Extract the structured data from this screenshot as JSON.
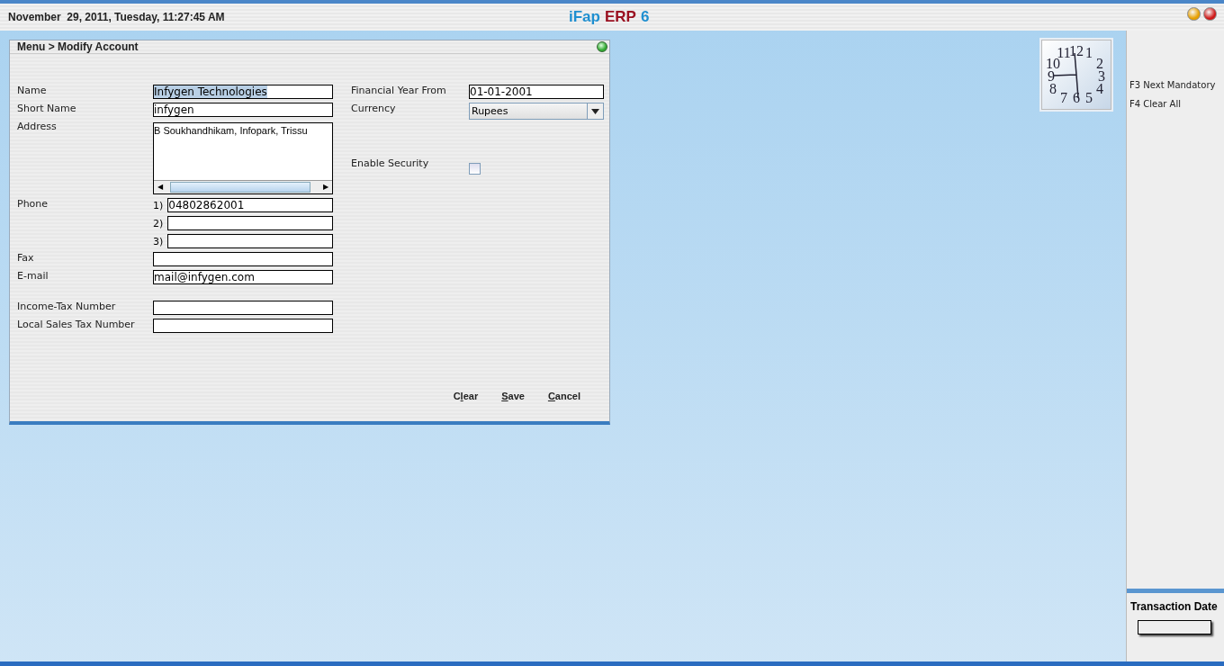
{
  "header": {
    "datetime": "November  29, 2011, Tuesday, 11:27:45 AM",
    "title": [
      {
        "text": "iFap",
        "color": "#1f8fd0"
      },
      {
        "text": "ERP",
        "color": "#9a1020"
      },
      {
        "text": "6",
        "color": "#1f8fd0"
      }
    ]
  },
  "panel": {
    "breadcrumb": "Menu > Modify Account",
    "left_fields": [
      {
        "kind": "text",
        "label": "Name",
        "value": "Infygen Technologies",
        "text_selected": true
      },
      {
        "kind": "text",
        "label": "Short Name",
        "value": "infygen"
      },
      {
        "kind": "textarea",
        "label": "Address",
        "value": "B Soukhandhikam, Infopark, Trissu",
        "scroll_left": "◀",
        "scroll_right": "▶"
      },
      {
        "kind": "phone",
        "label": "Phone",
        "lines": [
          {
            "number": "1)",
            "value": "04802862001"
          },
          {
            "number": "2)"
          },
          {
            "number": "3)"
          }
        ]
      },
      {
        "kind": "text",
        "label": "Fax"
      },
      {
        "kind": "text",
        "label": "E-mail",
        "value": "mail@infygen.com"
      },
      {
        "kind": "gap"
      },
      {
        "kind": "text",
        "label": "Income-Tax Number"
      },
      {
        "kind": "text",
        "label": "Local Sales Tax Number"
      }
    ],
    "right_fields": [
      {
        "kind": "text",
        "label": "Financial Year From",
        "value": "01-01-2001"
      },
      {
        "kind": "select",
        "label": "Currency",
        "value": "Rupees"
      },
      {
        "kind": "gap"
      },
      {
        "kind": "checkbox",
        "label": "Enable Security",
        "checked": false
      }
    ],
    "buttons": [
      {
        "before": "C",
        "key": "l",
        "after": "ear"
      },
      {
        "key": "S",
        "after": "ave"
      },
      {
        "key": "C",
        "after": "ancel"
      }
    ]
  },
  "clock": {
    "numerals": [
      "11",
      "12",
      "1",
      "10",
      "2",
      "9",
      "3",
      "8",
      "4",
      "7",
      "6",
      "5"
    ]
  },
  "shortcuts": [
    "F3 Next Mandatory",
    "F4 Clear All"
  ],
  "transaction_date": {
    "label": "Transaction Date"
  }
}
